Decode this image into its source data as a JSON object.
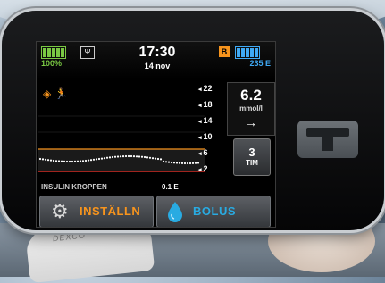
{
  "status_bar": {
    "battery_percent_label": "100%",
    "battery_level": 1.0,
    "time": "17:30",
    "date": "14 nov",
    "badge": "B",
    "insulin_units": "235 E",
    "insulin_level": 1.0
  },
  "graph": {
    "y_ticks": [
      "22",
      "18",
      "14",
      "10",
      "6",
      "2"
    ],
    "high_threshold": 10,
    "low_threshold": 3.9,
    "trace_color": "#ffffff",
    "high_line_color": "#f7941d",
    "low_line_color": "#ff3b30"
  },
  "glucose": {
    "value": "6.2",
    "unit": "mmol/l",
    "trend": "→"
  },
  "time_range": {
    "value": "3",
    "unit": "TIM"
  },
  "insulin_on_board": {
    "label": "INSULIN KROPPEN",
    "value": "0.1 E"
  },
  "buttons": {
    "options_label": "INSTÄLLN",
    "bolus_label": "BOLUS"
  },
  "background": {
    "sensor_text": "DEXCO"
  },
  "colors": {
    "accent_orange": "#f7941d",
    "accent_blue": "#29abe2",
    "battery_green": "#7ac943"
  }
}
